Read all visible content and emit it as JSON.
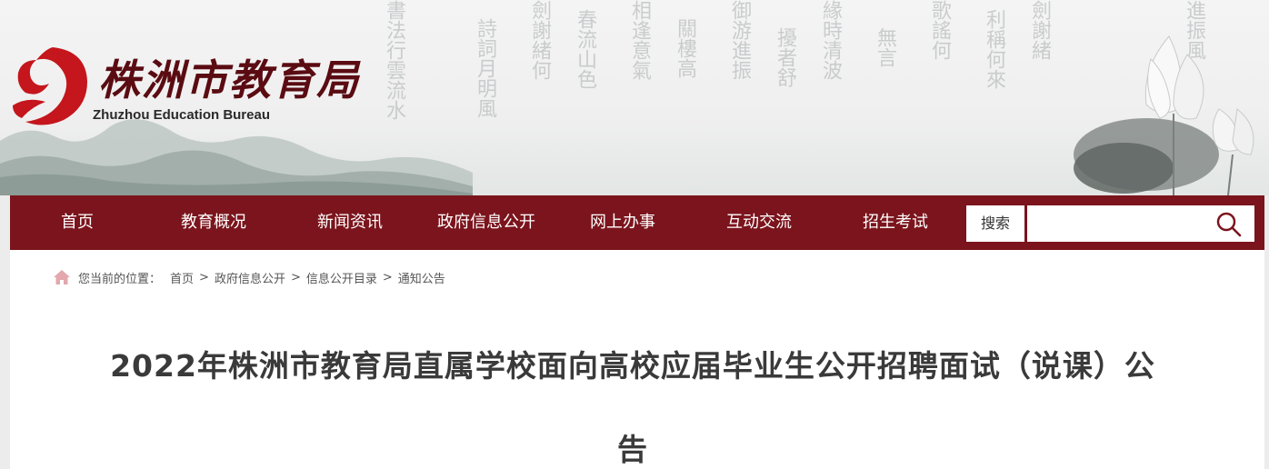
{
  "header": {
    "logo_title": "株洲市教育局",
    "logo_subtitle": "Zhuzhou Education Bureau",
    "logo_icon": "red-flame-emblem"
  },
  "nav": {
    "items": [
      {
        "label": "首页"
      },
      {
        "label": "教育概况"
      },
      {
        "label": "新闻资讯"
      },
      {
        "label": "政府信息公开"
      },
      {
        "label": "网上办事"
      },
      {
        "label": "互动交流"
      },
      {
        "label": "招生考试"
      }
    ],
    "search_label": "搜索",
    "search_placeholder": "",
    "search_icon": "search-icon"
  },
  "breadcrumb": {
    "prefix": "您当前的位置：",
    "items": [
      "首页",
      "政府信息公开",
      "信息公开目录",
      "通知公告"
    ],
    "separator": ">"
  },
  "article": {
    "title_line1": "2022年株洲市教育局直属学校面向高校应届毕业生公开招聘面试（说课）公",
    "title_line2": "告"
  },
  "colors": {
    "nav_bg": "#7b141c",
    "logo_red": "#c4161c",
    "title_text": "#3a3a3a"
  }
}
